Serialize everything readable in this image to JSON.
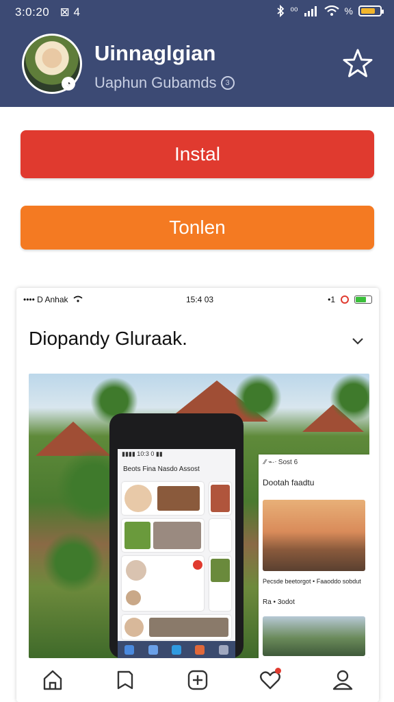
{
  "status_bar": {
    "time": "3:0:20",
    "left_glyph": "⊠ 4",
    "signal_text": "⁰⁰",
    "battery_text": "%",
    "battery_level": 0.8
  },
  "profile": {
    "name": "Uinnaglgian",
    "subtitle": "Uaphun Gubamds",
    "subtitle_badge": "3"
  },
  "actions": {
    "install_label": "Instal",
    "view_label": "Tonlen"
  },
  "inner": {
    "status_left": "•••• D Anhak",
    "status_time": "15:4 03",
    "status_right": "•1",
    "battery_level": 0.7,
    "title": "Diopandy Gluraak.",
    "phone_status": "▮▮▮▮   10:3 0 ▮▮",
    "phone_title": "Beots Fina Nasdo Assost",
    "panel_status": "⁄⁄   ⌁·ᐧ   Sost 6",
    "panel_heading": "Dootah faadtu",
    "panel_caption": "Pecsde beetorgot • Faaoddo sobdut",
    "panel_meta": "Ra • 3odot"
  },
  "colors": {
    "header": "#3c4a74",
    "install": "#e03a2f",
    "view": "#f47a22"
  },
  "icons": {
    "star": "star-icon",
    "chevron": "chevron-down-icon",
    "nav": [
      "home-icon",
      "bookmark-icon",
      "add-icon",
      "heart-icon",
      "profile-icon"
    ]
  }
}
